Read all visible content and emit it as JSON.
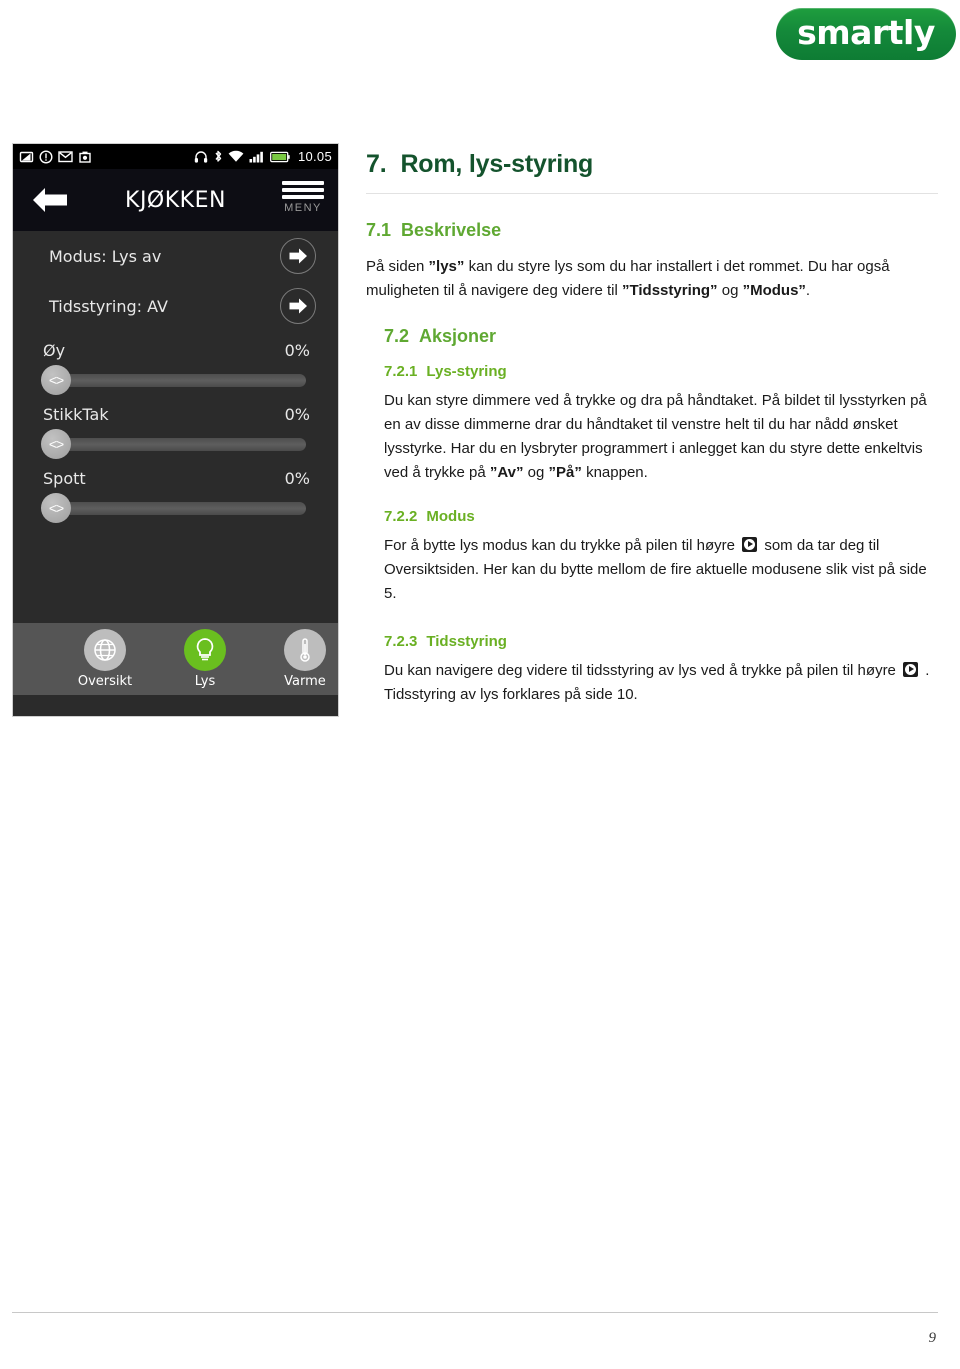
{
  "brand": {
    "logo_text": "smartly",
    "logo_color": "#15903b"
  },
  "phone": {
    "statusbar": {
      "time": "10.05",
      "left_icons": [
        "screenshot-icon",
        "warning-icon",
        "mail-icon",
        "camera-icon"
      ],
      "right_icons": [
        "headset-icon",
        "bluetooth-icon",
        "wifi-icon",
        "signal-icon",
        "battery-icon"
      ]
    },
    "header": {
      "back_label": "back-arrow",
      "title": "KJØKKEN",
      "menu_label": "MENY"
    },
    "nav_rows": [
      {
        "label": "Modus: Lys av"
      },
      {
        "label": "Tidsstyring: AV"
      }
    ],
    "dimmers": [
      {
        "label": "Øy",
        "value": "0%",
        "percent": 0
      },
      {
        "label": "StikkTak",
        "value": "0%",
        "percent": 0
      },
      {
        "label": "Spott",
        "value": "0%",
        "percent": 0
      }
    ],
    "slider_thumb_glyph": "<>",
    "tabs": [
      {
        "label": "Oversikt",
        "icon": "globe-icon",
        "active": false
      },
      {
        "label": "Lys",
        "icon": "lightbulb-icon",
        "active": true
      },
      {
        "label": "Varme",
        "icon": "thermometer-icon",
        "active": false
      }
    ],
    "active_color": "#6abf1f"
  },
  "document": {
    "h1": {
      "num": "7.",
      "title": "Rom, lys-styring"
    },
    "sections": [
      {
        "level": "h2",
        "num": "7.1",
        "title": "Beskrivelse",
        "body_parts": [
          {
            "t": "På siden ",
            "b": false
          },
          {
            "t": "”lys”",
            "b": true
          },
          {
            "t": " kan du styre lys som du har installert i det rommet. Du har også muligheten til å navigere deg videre til ",
            "b": false
          },
          {
            "t": "”Tidsstyring”",
            "b": true
          },
          {
            "t": " og ",
            "b": false
          },
          {
            "t": "”Modus”",
            "b": true
          },
          {
            "t": ".",
            "b": false
          }
        ]
      },
      {
        "level": "h2",
        "num": "7.2",
        "title": "Aksjoner"
      },
      {
        "level": "h3",
        "num": "7.2.1",
        "title": "Lys-styring",
        "body_parts": [
          {
            "t": "Du kan styre dimmere ved å trykke og dra på håndtaket. På bildet til lysstyrken på en av disse dimmerne drar du håndtaket til venstre helt til du har nådd ønsket lysstyrke. Har du en lysbryter programmert i anlegget kan du styre dette enkeltvis ved å trykke på ",
            "b": false
          },
          {
            "t": "”Av”",
            "b": true
          },
          {
            "t": " og ",
            "b": false
          },
          {
            "t": "”På”",
            "b": true
          },
          {
            "t": " knappen.",
            "b": false
          }
        ]
      },
      {
        "level": "h3",
        "num": "7.2.2",
        "title": "Modus",
        "body_parts": [
          {
            "t": "For å bytte lys modus kan du trykke på pilen til høyre ",
            "b": false
          },
          {
            "t": "[arrow-icon]",
            "b": false,
            "icon": true
          },
          {
            "t": " som da tar deg til Oversiktsiden. Her kan du bytte mellom de fire aktuelle modusene slik vist på side 5.",
            "b": false
          }
        ]
      },
      {
        "level": "h3",
        "num": "7.2.3",
        "title": "Tidsstyring",
        "body_parts": [
          {
            "t": "Du kan navigere deg videre til tidsstyring av lys ved å trykke på pilen til høyre ",
            "b": false
          },
          {
            "t": "[arrow-icon]",
            "b": false,
            "icon": true
          },
          {
            "t": " . Tidsstyring av lys forklares på side 10.",
            "b": false
          }
        ]
      }
    ]
  },
  "footer": {
    "page_number": "9"
  }
}
